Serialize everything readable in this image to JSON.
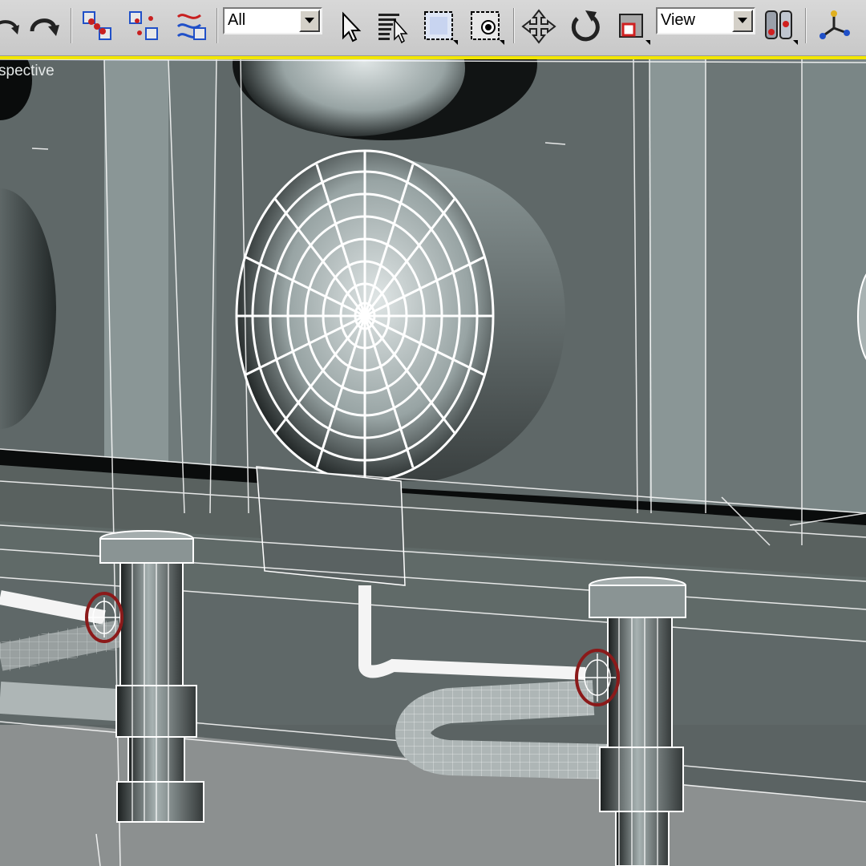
{
  "toolbar": {
    "buttons": [
      {
        "name": "undo-button",
        "icon": "undo-icon"
      },
      {
        "name": "redo-button",
        "icon": "redo-icon"
      },
      {
        "name": "select-and-link-button",
        "icon": "link-icon"
      },
      {
        "name": "unlink-selection-button",
        "icon": "unlink-icon"
      },
      {
        "name": "bind-to-space-warp-button",
        "icon": "space-warp-icon"
      },
      {
        "name": "select-object-button",
        "icon": "cursor-arrow-icon"
      },
      {
        "name": "select-by-name-button",
        "icon": "select-by-name-icon"
      },
      {
        "name": "rectangular-selection-button",
        "icon": "rect-selection-icon"
      },
      {
        "name": "window-crossing-button",
        "icon": "window-crossing-icon"
      },
      {
        "name": "select-and-move-button",
        "icon": "move-icon"
      },
      {
        "name": "select-and-rotate-button",
        "icon": "rotate-icon"
      },
      {
        "name": "select-and-scale-button",
        "icon": "scale-icon"
      },
      {
        "name": "use-pivot-point-button",
        "icon": "pivot-icon"
      },
      {
        "name": "select-and-manipulate-button",
        "icon": "manipulate-icon"
      }
    ],
    "selection_filter": {
      "value": "All"
    },
    "reference_coordinate_system": {
      "value": "View"
    }
  },
  "viewport": {
    "label": "Perspective",
    "label_visible": "spective",
    "active_border_color": "#f2e600",
    "background_color": "#5b6363",
    "wireframe_color": "#ffffff",
    "valve_handle_color": "#8b1a1a"
  }
}
